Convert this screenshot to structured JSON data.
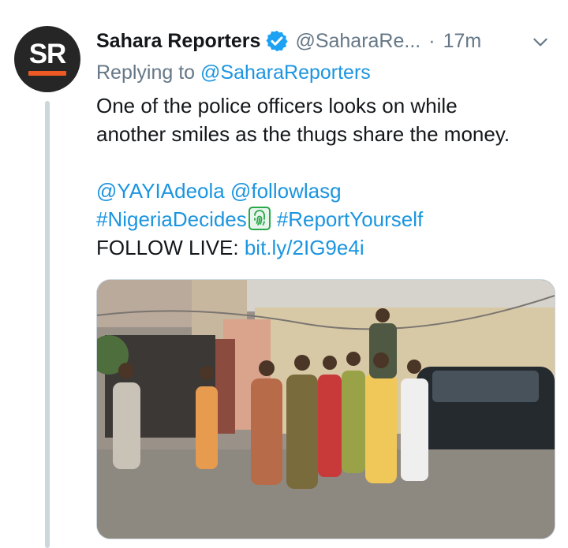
{
  "tweet": {
    "avatar_text": "SR",
    "display_name": "Sahara Reporters",
    "handle": "@SaharaRe...",
    "separator": "·",
    "time": "17m",
    "replying_prefix": "Replying to",
    "replying_handle": "@SaharaReporters",
    "text_line1": "One of the police officers looks on while",
    "text_line2": "another smiles as the thugs share the money.",
    "mention1": "@YAYIAdeola",
    "mention2": "@followlasg",
    "hashtag1": "#NigeriaDecides",
    "hashtag2": "#ReportYourself",
    "follow_label": "FOLLOW LIVE:",
    "follow_link": "bit.ly/2IG9e4i"
  },
  "icons": {
    "verified": "verified-badge-icon",
    "menu": "chevron-down-icon",
    "hashflag": "fingerprint-hashflag-icon"
  },
  "colors": {
    "link": "#1b95e0",
    "secondary_text": "#657786",
    "avatar_bg": "#262626",
    "avatar_accent": "#ef5a24"
  }
}
